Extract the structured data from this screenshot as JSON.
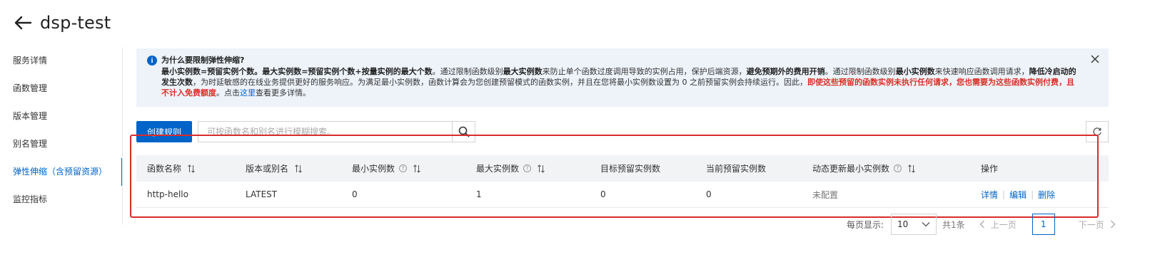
{
  "header": {
    "title": "dsp-test"
  },
  "sidebar": {
    "items": [
      {
        "label": "服务详情"
      },
      {
        "label": "函数管理"
      },
      {
        "label": "版本管理"
      },
      {
        "label": "别名管理"
      },
      {
        "label": "弹性伸缩（含预留资源）",
        "active": true
      },
      {
        "label": "监控指标"
      }
    ]
  },
  "notice": {
    "title": "为什么要限制弹性伸缩?",
    "p1": "最小实例数=预留实例个数。最大实例数=预留实例个数+按量实例的最大个数",
    "p2": "。通过限制函数级别",
    "p3": "最大实例数",
    "p4": "来防止单个函数过度调用导致的实例占用，保护后端资源，",
    "p5": "避免预期外的费用开销",
    "p6": "。通过限制函数级别",
    "p7": "最小实例数",
    "p8": "来快速响应函数调用请求，",
    "p9": "降低冷启动的发生次数",
    "p10": "，为时延敏感的在线业务提供更好的服务响应。为满足最小实例数，函数计算会为您创建预留模式的函数实例，并且在您将最小实例数设置为 0 之前预留实例会持续运行。因此，",
    "p11": "即使这些预留的函数实例未执行任何请求，您也需要为这些函数实例付费，且不计入免费额度",
    "p12": "。点击",
    "link": "这里",
    "p13": "查看更多详情。"
  },
  "toolbar": {
    "create_label": "创建规则",
    "search_placeholder": "可按函数名和别名进行模糊搜索。"
  },
  "table": {
    "headers": [
      "函数名称",
      "版本或别名",
      "最小实例数",
      "最大实例数",
      "目标预留实例数",
      "当前预留实例数",
      "动态更新最小实例数",
      "操作"
    ],
    "rows": [
      {
        "function_name": "http-hello",
        "version_alias": "LATEST",
        "min_instances": "0",
        "max_instances": "1",
        "target_reserved": "0",
        "current_reserved": "0",
        "dynamic_update": "未配置",
        "actions": [
          "详情",
          "编辑",
          "删除"
        ]
      }
    ]
  },
  "pager": {
    "page_size_label": "每页显示:",
    "page_size": "10",
    "total": "共1条",
    "prev": "上一页",
    "page": "1",
    "next": "下一页"
  },
  "colors": {
    "accent": "#0064c8",
    "highlight_border": "#d92c2c",
    "notice_bg": "#eef3fa",
    "warning_text": "#d93026"
  }
}
